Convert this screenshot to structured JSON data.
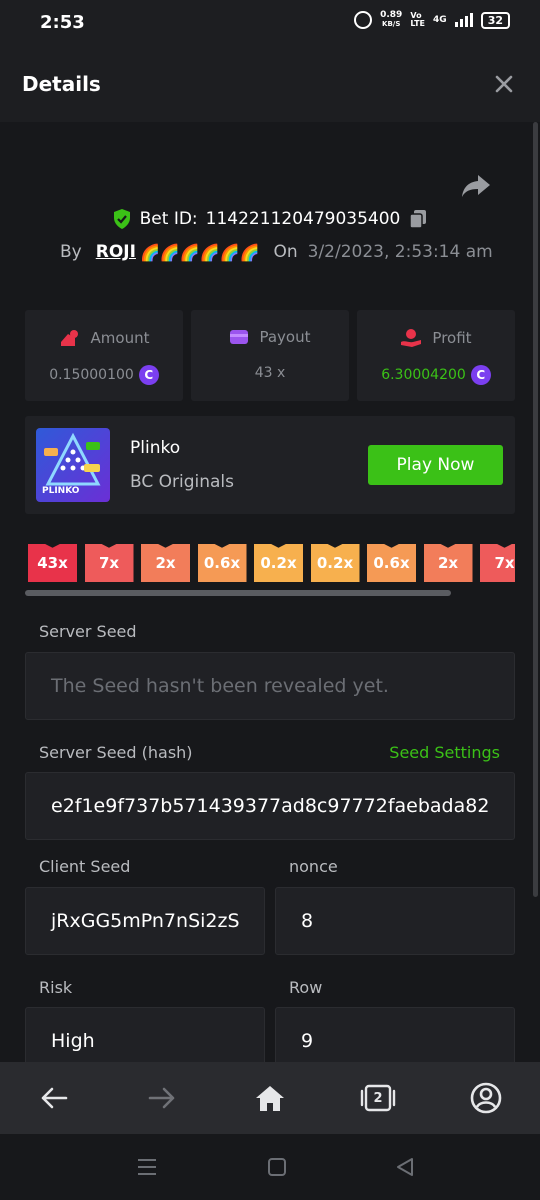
{
  "status_bar": {
    "time": "2:53",
    "speed_value": "0.89",
    "speed_unit": "KB/S",
    "volte_top": "Vo",
    "volte_bottom": "LTE",
    "network": "4G",
    "battery": "32"
  },
  "header": {
    "title": "Details",
    "close_icon": "close-icon"
  },
  "bet": {
    "id_label": "Bet ID:",
    "id_value": "114221120479035400",
    "by_label": "By",
    "username": "ROJI",
    "username_emoji": "🌈🌈🌈🌈🌈🌈",
    "on_label": "On",
    "date": "3/2/2023, 2:53:14 am"
  },
  "stats": {
    "amount": {
      "label": "Amount",
      "value": "0.15000100",
      "icon": "amount-icon"
    },
    "payout": {
      "label": "Payout",
      "value": "43 x",
      "icon": "wallet-icon"
    },
    "profit": {
      "label": "Profit",
      "value": "6.30004200",
      "icon": "profit-icon"
    }
  },
  "game": {
    "name": "Plinko",
    "provider": "BC Originals",
    "thumb_label": "PLINKO",
    "play_label": "Play Now"
  },
  "multipliers": [
    {
      "label": "43x",
      "color": "#e8334a"
    },
    {
      "label": "7x",
      "color": "#ee5b5b"
    },
    {
      "label": "2x",
      "color": "#f27d5a"
    },
    {
      "label": "0.6x",
      "color": "#f59a55"
    },
    {
      "label": "0.2x",
      "color": "#f7b04e"
    },
    {
      "label": "0.2x",
      "color": "#f7b04e"
    },
    {
      "label": "0.6x",
      "color": "#f59a55"
    },
    {
      "label": "2x",
      "color": "#f27d5a"
    },
    {
      "label": "7x",
      "color": "#ee5b5b"
    }
  ],
  "seeds": {
    "server_seed_label": "Server Seed",
    "server_seed_placeholder": "The Seed hasn't been revealed yet.",
    "server_hash_label": "Server Seed (hash)",
    "seed_settings_label": "Seed Settings",
    "server_hash_value": "e2f1e9f737b571439377ad8c97772faebada82",
    "client_seed_label": "Client Seed",
    "client_seed_value": "jRxGG5mPn7nSi2zS",
    "nonce_label": "nonce",
    "nonce_value": "8",
    "risk_label": "Risk",
    "risk_value": "High",
    "row_label": "Row",
    "row_value": "9"
  },
  "bottom_nav": {
    "tab_count": "2"
  },
  "colors": {
    "accent_green": "#3bc117",
    "coin_purple": "#7b3ff0",
    "background": "#17181b",
    "card": "#202125"
  }
}
